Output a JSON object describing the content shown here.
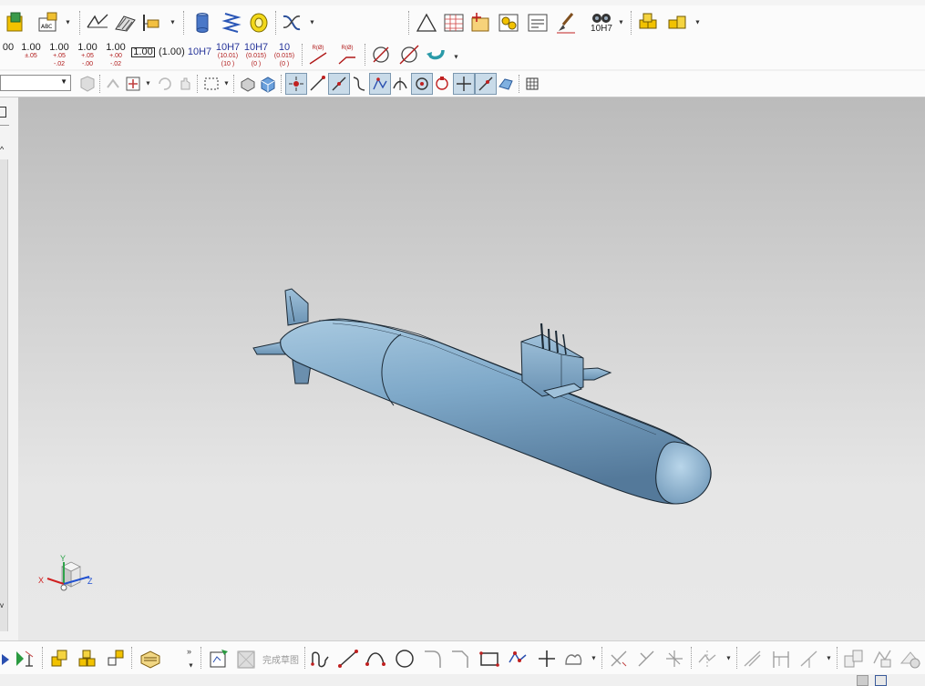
{
  "toolbar_dimensions": {
    "tolerances": [
      {
        "main": "00",
        "sub1": "",
        "sub2": ""
      },
      {
        "main": "1.00",
        "sub1": "±.05",
        "sub2": ""
      },
      {
        "main": "1.00",
        "sub1": "+.05",
        "sub2": "-.02"
      },
      {
        "main": "1.00",
        "sub1": "+.05",
        "sub2": "-.00"
      },
      {
        "main": "1.00",
        "sub1": "+.00",
        "sub2": "-.02"
      }
    ],
    "basic_dim": "1.00",
    "ref_dim": "(1.00)",
    "fit_plain": "10H7",
    "fit_limits": [
      {
        "main": "10H7",
        "sub1": "(10.01)",
        "sub2": "(10  )"
      },
      {
        "main": "10H7",
        "sub1": "(0.015)",
        "sub2": "(0    )"
      },
      {
        "main": "10",
        "sub1": "(0.015)",
        "sub2": "(0    )"
      }
    ],
    "radius_label_1": "R(Ø)",
    "radius_label_2": "R(Ø)"
  },
  "toolbar_top": {
    "fit_symbol_label": "10H7"
  },
  "sketch_toolbar": {
    "finish_sketch_label": "完成草图"
  },
  "triad": {
    "x_label": "X",
    "y_label": "Y",
    "z_label": "Z"
  },
  "colors": {
    "model": "#7fa9c9",
    "model_dark": "#4f7593",
    "model_light": "#b4d2e6",
    "outline": "#1c2a36"
  }
}
